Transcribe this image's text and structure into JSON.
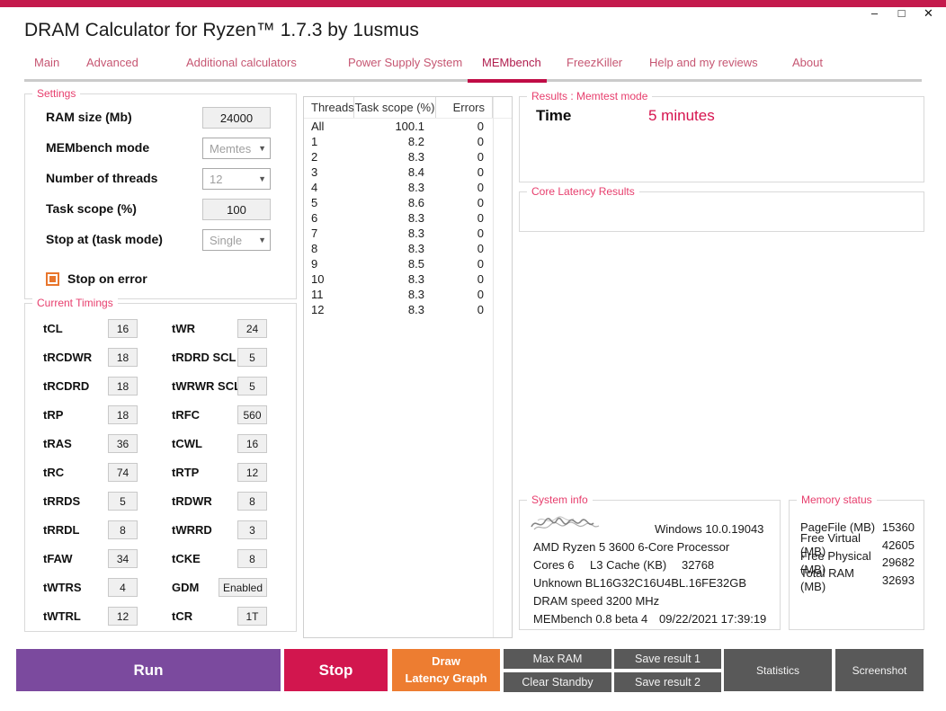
{
  "window": {
    "title": "DRAM Calculator for Ryzen™ 1.7.3 by 1usmus",
    "controls": {
      "minimize": "–",
      "maximize": "□",
      "close": "✕"
    }
  },
  "tabs": [
    {
      "label": "Main",
      "active": false
    },
    {
      "label": "Advanced",
      "active": false
    },
    {
      "label": "Additional calculators",
      "active": false
    },
    {
      "label": "Power Supply System",
      "active": false
    },
    {
      "label": "MEMbench",
      "active": true
    },
    {
      "label": "FreezKiller",
      "active": false
    },
    {
      "label": "Help and my reviews",
      "active": false
    },
    {
      "label": "About",
      "active": false
    }
  ],
  "settings": {
    "title": "Settings",
    "fields": [
      {
        "label": "RAM size (Mb)",
        "value": "24000",
        "type": "input"
      },
      {
        "label": "MEMbench mode",
        "value": "Memtes",
        "type": "select"
      },
      {
        "label": "Number of threads",
        "value": "12",
        "type": "select"
      },
      {
        "label": "Task scope (%)",
        "value": "100",
        "type": "input"
      },
      {
        "label": "Stop at (task mode)",
        "value": "Single",
        "type": "select"
      }
    ],
    "checkbox": {
      "label": "Stop on error",
      "checked": true
    }
  },
  "timings": {
    "title": "Current Timings",
    "left": [
      [
        "tCL",
        "16"
      ],
      [
        "tRCDWR",
        "18"
      ],
      [
        "tRCDRD",
        "18"
      ],
      [
        "tRP",
        "18"
      ],
      [
        "tRAS",
        "36"
      ],
      [
        "tRC",
        "74"
      ],
      [
        "tRRDS",
        "5"
      ],
      [
        "tRRDL",
        "8"
      ],
      [
        "tFAW",
        "34"
      ],
      [
        "tWTRS",
        "4"
      ],
      [
        "tWTRL",
        "12"
      ]
    ],
    "right": [
      [
        "tWR",
        "24"
      ],
      [
        "tRDRD SCL",
        "5"
      ],
      [
        "tWRWR SCL",
        "5"
      ],
      [
        "tRFC",
        "560"
      ],
      [
        "tCWL",
        "16"
      ],
      [
        "tRTP",
        "12"
      ],
      [
        "tRDWR",
        "8"
      ],
      [
        "tWRRD",
        "3"
      ],
      [
        "tCKE",
        "8"
      ],
      [
        "GDM",
        "Enabled"
      ],
      [
        "tCR",
        "1T"
      ]
    ]
  },
  "thread_table": {
    "columns": [
      "Threads",
      "Task scope (%)",
      "Errors"
    ],
    "rows": [
      [
        "All",
        "100.1",
        "0"
      ],
      [
        "1",
        "8.2",
        "0"
      ],
      [
        "2",
        "8.3",
        "0"
      ],
      [
        "3",
        "8.4",
        "0"
      ],
      [
        "4",
        "8.3",
        "0"
      ],
      [
        "5",
        "8.6",
        "0"
      ],
      [
        "6",
        "8.3",
        "0"
      ],
      [
        "7",
        "8.3",
        "0"
      ],
      [
        "8",
        "8.3",
        "0"
      ],
      [
        "9",
        "8.5",
        "0"
      ],
      [
        "10",
        "8.3",
        "0"
      ],
      [
        "11",
        "8.3",
        "0"
      ],
      [
        "12",
        "8.3",
        "0"
      ]
    ]
  },
  "results": {
    "title": "Results : Memtest mode",
    "time_label": "Time",
    "time_value": "5 minutes"
  },
  "core_latency": {
    "title": "Core Latency Results"
  },
  "system_info": {
    "title": "System info",
    "os": "Windows 10.0.19043",
    "cpu": "AMD Ryzen 5 3600 6-Core Processor",
    "cores": "Cores 6",
    "l3_label": "L3 Cache (KB)",
    "l3_value": "32768",
    "ram_module": "Unknown BL16G32C16U4BL.16FE32GB",
    "dram_speed": "DRAM speed 3200 MHz",
    "bench_version": "MEMbench 0.8 beta 4",
    "datetime": "09/22/2021 17:39:19"
  },
  "memory_status": {
    "title": "Memory status",
    "rows": [
      [
        "PageFile (MB)",
        "15360"
      ],
      [
        "Free Virtual (MB)",
        "42605"
      ],
      [
        "Free Physical (MB)",
        "29682"
      ],
      [
        "Total RAM (MB)",
        "32693"
      ]
    ]
  },
  "actions": {
    "run": "Run",
    "stop": "Stop",
    "draw_line1": "Draw",
    "draw_line2": "Latency Graph",
    "max_ram": "Max RAM",
    "clear_standby": "Clear Standby",
    "save1": "Save result 1",
    "save2": "Save result 2",
    "statistics": "Statistics",
    "screenshot": "Screenshot"
  },
  "colors": {
    "accent_crimson": "#c41a4c",
    "tab_inactive": "#c65672",
    "tab_active": "#b01e4e",
    "group_label": "#e73e6d",
    "result_value": "#d6134e",
    "run_purple": "#7b4a9e",
    "stop_crimson": "#d2164e",
    "draw_orange": "#ed7d31",
    "gray_button": "#595959",
    "checkbox_orange": "#e8762d"
  }
}
